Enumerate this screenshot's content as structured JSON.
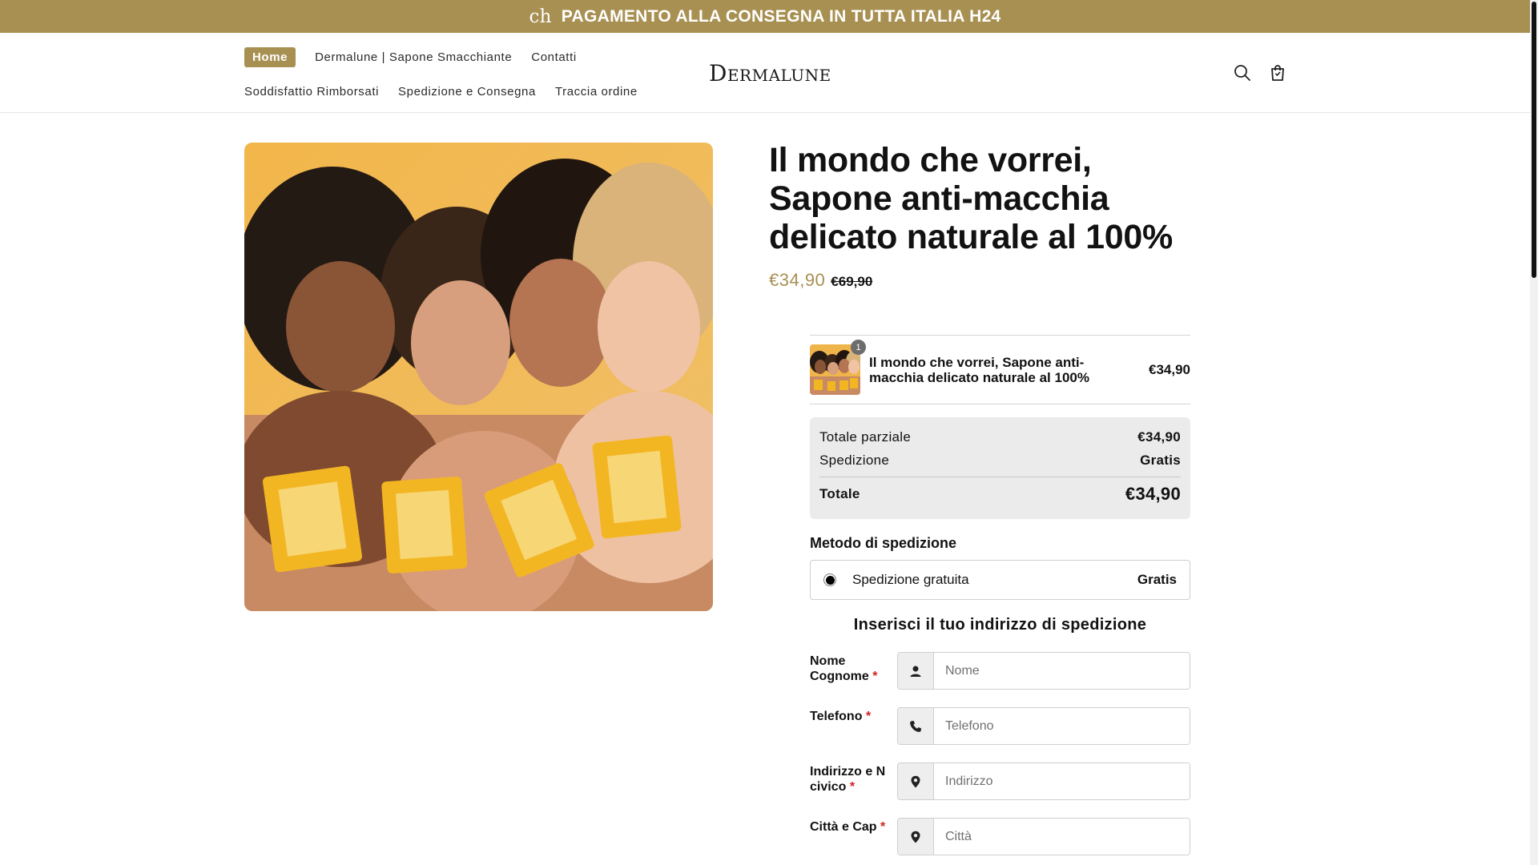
{
  "announcement": {
    "prefix": "ch",
    "text": "PAGAMENTO ALLA CONSEGNA IN TUTTA ITALIA H24"
  },
  "nav": {
    "row1": [
      {
        "label": "Home",
        "active": true
      },
      {
        "label": "Dermalune | Sapone Smacchiante"
      },
      {
        "label": "Contatti"
      }
    ],
    "row2": [
      {
        "label": "Soddisfattio Rimborsati"
      },
      {
        "label": "Spedizione e Consegna"
      },
      {
        "label": "Traccia ordine"
      }
    ]
  },
  "logo": {
    "first": "D",
    "rest": "ERMALUNE"
  },
  "header_icons": [
    "search-icon",
    "cart-icon"
  ],
  "product": {
    "title": "Il mondo che vorrei, Sapone anti-macchia delicato naturale al 100%",
    "price": "€34,90",
    "compare_price": "€69,90"
  },
  "order": {
    "item_name": "Il mondo che vorrei, Sapone anti-macchia delicato naturale al 100%",
    "item_qty": "1",
    "item_price": "€34,90",
    "subtotal_label": "Totale parziale",
    "subtotal_value": "€34,90",
    "shipping_label": "Spedizione",
    "shipping_value": "Gratis",
    "total_label": "Totale",
    "total_value": "€34,90"
  },
  "shipping_method": {
    "heading": "Metodo di spedizione",
    "option_label": "Spedizione gratuita",
    "option_price": "Gratis"
  },
  "address": {
    "heading": "Inserisci il tuo indirizzo di spedizione",
    "fields": [
      {
        "label": "Nome Cognome",
        "placeholder": "Nome"
      },
      {
        "label": "Telefono",
        "placeholder": "Telefono"
      },
      {
        "label": "Indirizzo e N civico",
        "placeholder": "Indirizzo"
      },
      {
        "label": "Città e Cap",
        "placeholder": "Città"
      }
    ],
    "required_mark": "*"
  },
  "colors": {
    "accent": "#a89052",
    "required": "#d22020"
  }
}
